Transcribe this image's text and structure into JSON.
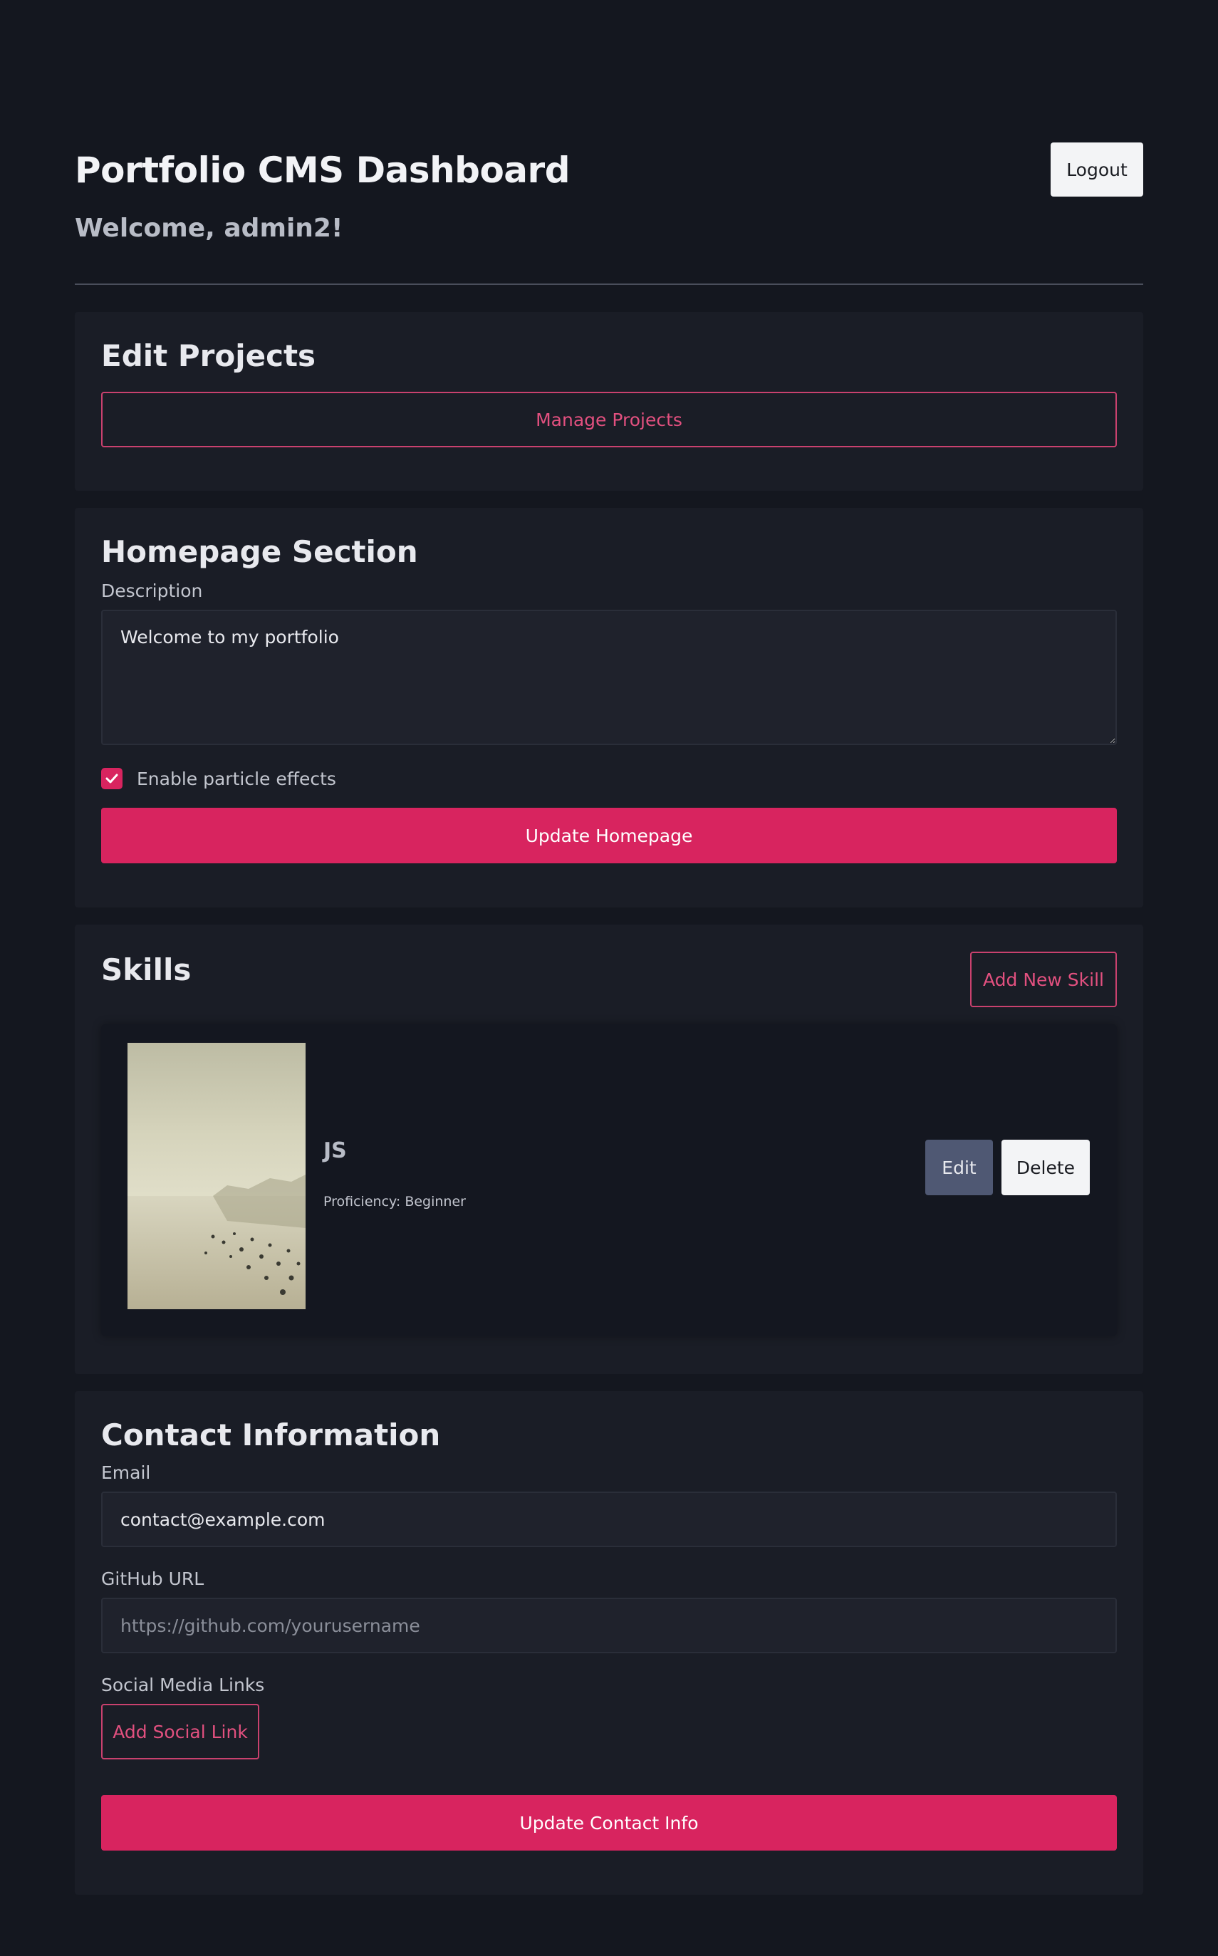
{
  "header": {
    "title": "Portfolio CMS Dashboard",
    "welcome": "Welcome, admin2!",
    "logout_label": "Logout"
  },
  "projects": {
    "heading": "Edit Projects",
    "manage_label": "Manage Projects"
  },
  "homepage": {
    "heading": "Homepage Section",
    "description_label": "Description",
    "description_value": "Welcome to my portfolio",
    "particle_label": "Enable particle effects",
    "particle_checked": true,
    "update_label": "Update Homepage"
  },
  "skills": {
    "heading": "Skills",
    "add_label": "Add New Skill",
    "items": [
      {
        "name": "JS",
        "proficiency": "Proficiency: Beginner",
        "edit_label": "Edit",
        "delete_label": "Delete"
      }
    ]
  },
  "contact": {
    "heading": "Contact Information",
    "email_label": "Email",
    "email_value": "contact@example.com",
    "github_label": "GitHub URL",
    "github_placeholder": "https://github.com/yourusername",
    "social_label": "Social Media Links",
    "add_social_label": "Add Social Link",
    "update_label": "Update Contact Info"
  },
  "colors": {
    "background": "#14171f",
    "card": "#1a1d26",
    "accent": "#d8245f",
    "edit_button": "#4f5873"
  }
}
